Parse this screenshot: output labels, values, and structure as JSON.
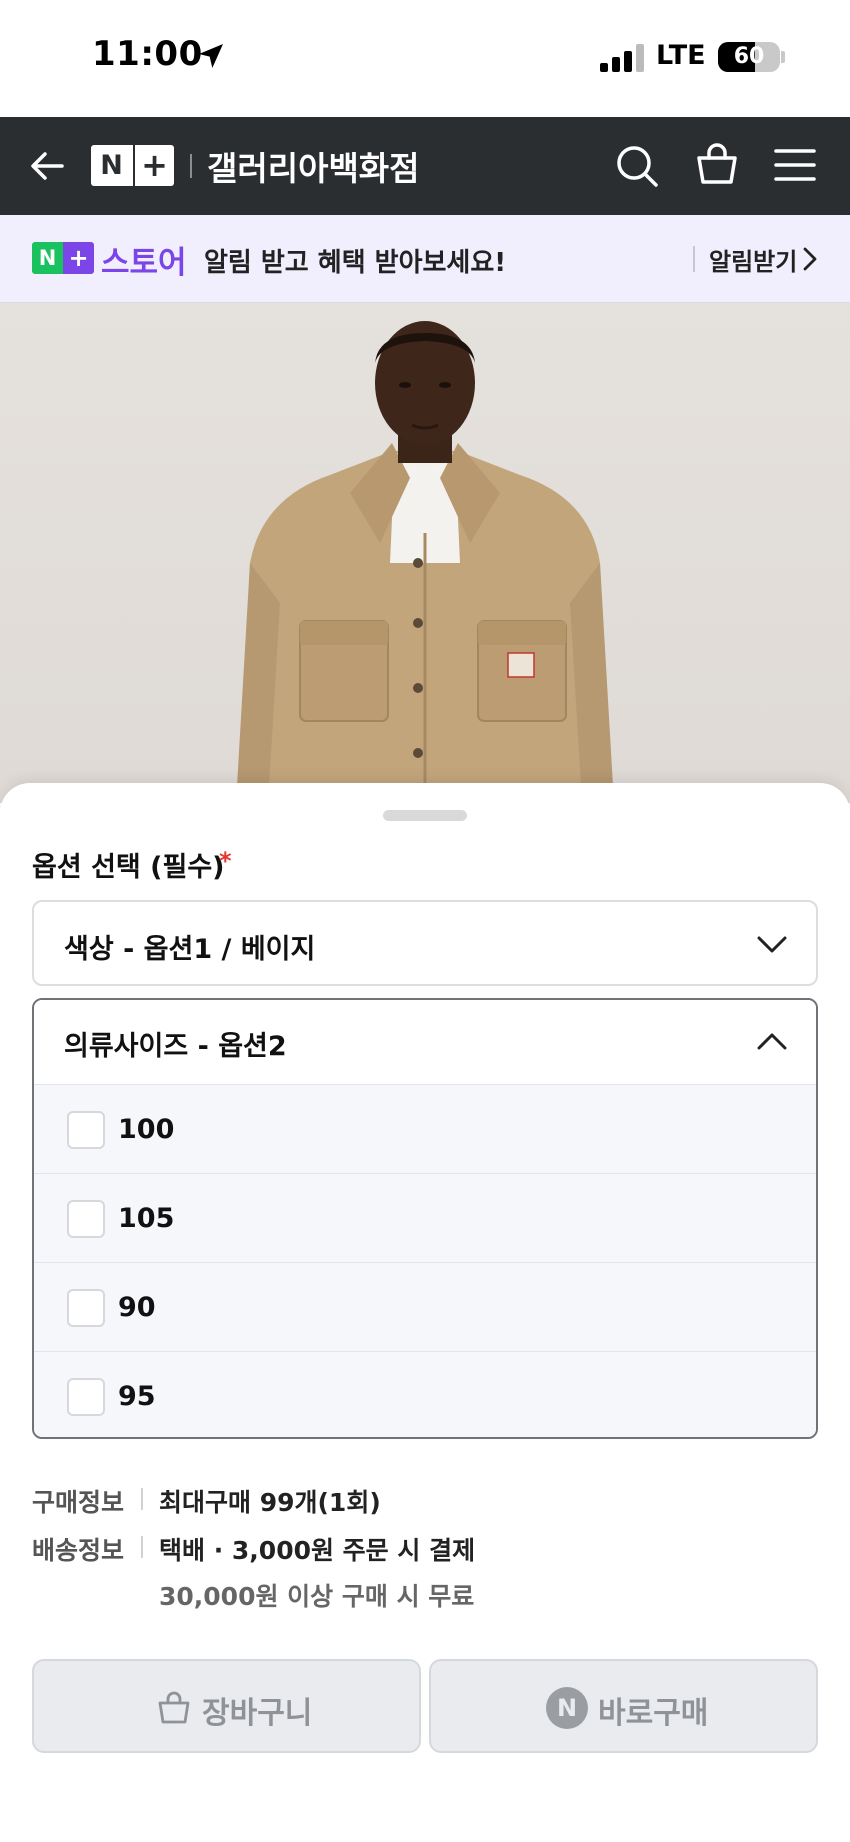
{
  "status_bar": {
    "time": "11:00",
    "network": "LTE",
    "battery_percent": "60",
    "battery_level": 0.6,
    "icons": [
      "location-arrow-icon",
      "signal-bars-icon",
      "battery-icon"
    ]
  },
  "header": {
    "logo_n": "N",
    "logo_plus": "+",
    "store_name": "갤러리아백화점",
    "icons": [
      "back-arrow-icon",
      "search-icon",
      "shopping-bag-icon",
      "hamburger-menu-icon"
    ],
    "background_color": "#2b2e31"
  },
  "notice": {
    "badge_n": "N",
    "badge_plus": "+",
    "brand": "스토어",
    "message": "알림 받고 혜택 받아보세요!",
    "action": "알림받기",
    "brand_color": "#7b45e8",
    "background_color": "#f1eefd"
  },
  "product_image": {
    "description_icon": "product-photo"
  },
  "options": {
    "title": "옵션 선택 (필수)",
    "required_mark": "*",
    "color_select": {
      "label": "색상 - 옵션1 / 베이지",
      "expanded": false
    },
    "size_select": {
      "label": "의류사이즈 - 옵션2",
      "expanded": true,
      "items": [
        {
          "label": "100",
          "checked": false
        },
        {
          "label": "105",
          "checked": false
        },
        {
          "label": "90",
          "checked": false
        },
        {
          "label": "95",
          "checked": false
        }
      ]
    }
  },
  "purchase_info": {
    "label": "구매정보",
    "value": "최대구매 99개(1회)"
  },
  "shipping_info": {
    "label": "배송정보",
    "value": "택배 · 3,000원 주문 시 결제",
    "sub": "30,000원 이상 구매 시 무료"
  },
  "buttons": {
    "cart": "장바구니",
    "buy_now": "바로구매",
    "buy_icon_letter": "N"
  }
}
